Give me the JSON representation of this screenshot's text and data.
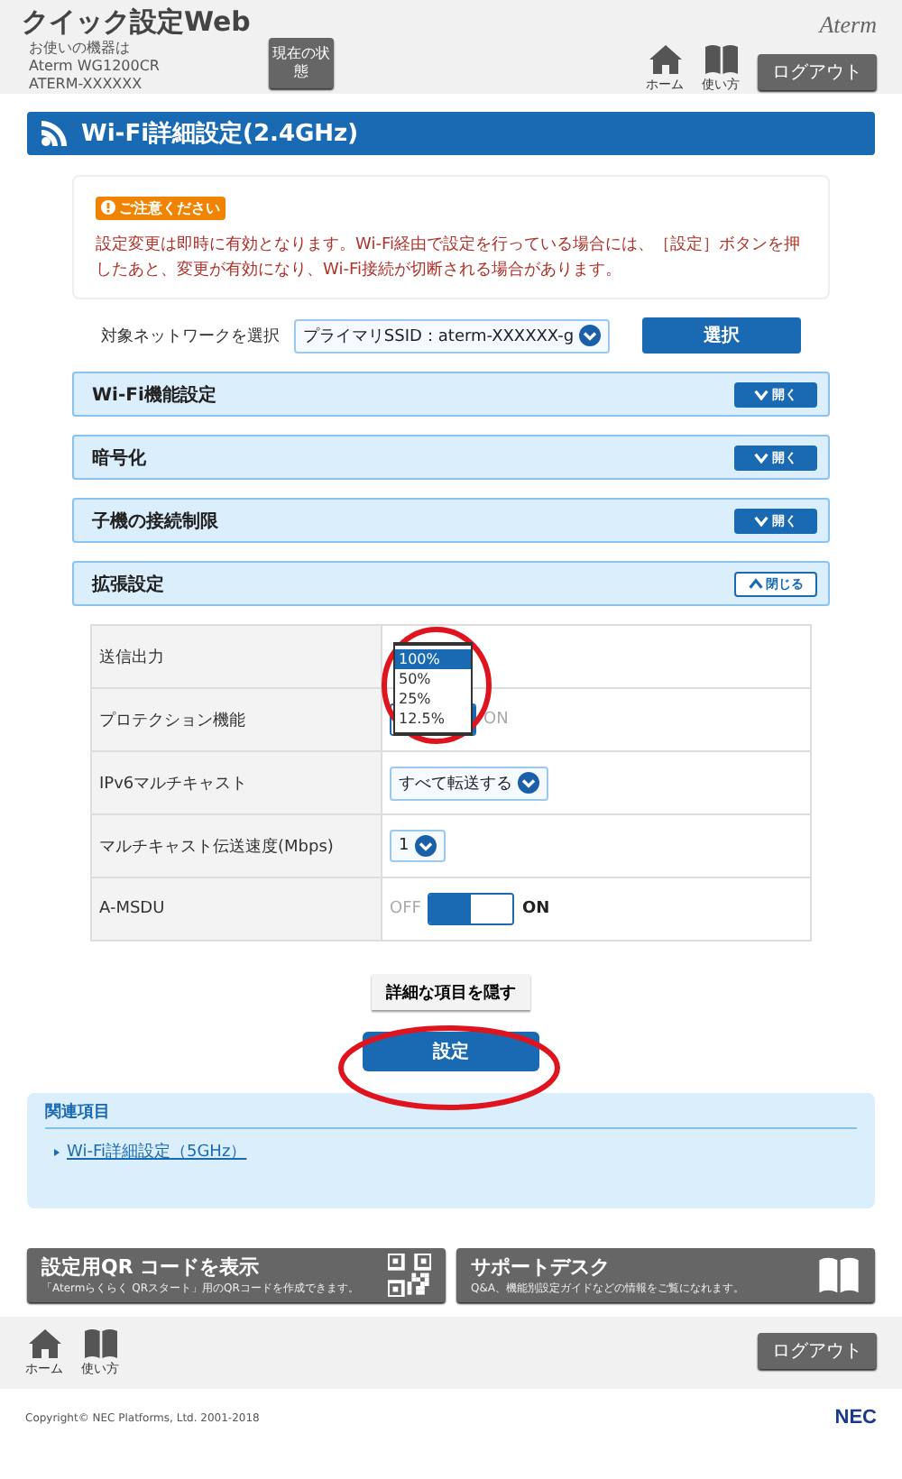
{
  "header": {
    "title": "クイック設定Web",
    "device_lines": [
      "お使いの機器は",
      "Aterm WG1200CR",
      "ATERM-XXXXXX"
    ],
    "status_button": "現在の状態",
    "nav": [
      {
        "kind": "home",
        "label": "ホーム"
      },
      {
        "kind": "book",
        "label": "使い方"
      }
    ],
    "logout": "ログアウト",
    "brand": "Aterm"
  },
  "page_title": "Wi-Fi詳細設定(2.4GHz)",
  "notice": {
    "badge": "ご注意ください",
    "text": "設定変更は即時に有効となります。Wi-Fi経由で設定を行っている場合には、［設定］ボタンを押したあと、変更が有効になり、Wi-Fi接続が切断される場合があります。"
  },
  "network": {
    "label": "対象ネットワークを選択",
    "value": "プライマリSSID：aterm-XXXXXX-g",
    "button": "選択"
  },
  "sections": [
    {
      "title": "Wi-Fi機能設定",
      "expanded": false,
      "toggle": "開く"
    },
    {
      "title": "暗号化",
      "expanded": false,
      "toggle": "開く"
    },
    {
      "title": "子機の接続制限",
      "expanded": false,
      "toggle": "開く"
    },
    {
      "title": "拡張設定",
      "expanded": true,
      "toggle": "閉じる"
    }
  ],
  "settings": [
    {
      "kind": "list",
      "label": "送信出力",
      "options": [
        {
          "label": "100%",
          "selected": true
        },
        {
          "label": "50%",
          "selected": false
        },
        {
          "label": "25%",
          "selected": false
        },
        {
          "label": "12.5%",
          "selected": false
        }
      ]
    },
    {
      "kind": "toggle",
      "label": "プロテクション機能",
      "on": false,
      "on_label": "ON"
    },
    {
      "kind": "select",
      "label": "IPv6マルチキャスト",
      "value": "すべて転送する"
    },
    {
      "kind": "select",
      "label": "マルチキャスト伝送速度(Mbps)",
      "value": "1"
    },
    {
      "kind": "toggle",
      "label": "A-MSDU",
      "on": true,
      "off_label": "OFF",
      "on_label": "ON"
    }
  ],
  "hide_button": "詳細な項目を隠す",
  "apply_button": "設定",
  "related": {
    "title": "関連項目",
    "links": [
      "Wi-Fi詳細設定（5GHz）"
    ]
  },
  "cards": [
    {
      "kind": "qr",
      "title": "設定用QR コードを表示",
      "text": "「Atermらくらく QRスタート」用のQRコードを作成できます。"
    },
    {
      "kind": "book",
      "title": "サポートデスク",
      "text": "Q&A、機能別設定ガイドなどの情報をご覧になれます。"
    }
  ],
  "footer": {
    "nav": [
      {
        "kind": "home",
        "label": "ホーム"
      },
      {
        "kind": "book",
        "label": "使い方"
      }
    ],
    "logout": "ログアウト",
    "copyright": "Copyright© NEC Platforms, Ltd. 2001-2018",
    "brand": "NEC"
  }
}
